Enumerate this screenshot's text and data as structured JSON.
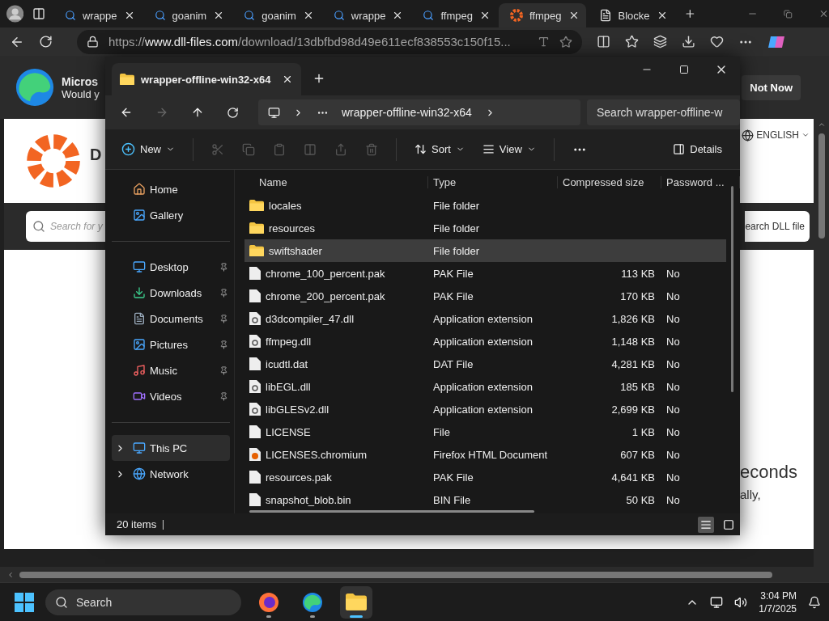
{
  "browser": {
    "tabs": [
      {
        "title": "wrappe",
        "kind": "search",
        "selected": false
      },
      {
        "title": "goanim",
        "kind": "search",
        "selected": false
      },
      {
        "title": "goanim",
        "kind": "search",
        "selected": false
      },
      {
        "title": "wrappe",
        "kind": "search",
        "selected": false
      },
      {
        "title": "ffmpeg",
        "kind": "search",
        "selected": false
      },
      {
        "title": "ffmpeg",
        "kind": "gear",
        "selected": true
      },
      {
        "title": "Blocke",
        "kind": "page",
        "selected": false
      }
    ],
    "address": "https://**www.dll-files.com**/download/13dbfbd98d49e611ecf838553c150f15...",
    "infobar": {
      "title": "Micros",
      "subtitle": "Would y",
      "button": "Not Now"
    },
    "site": {
      "title": "D",
      "search_placeholder": "Search for y",
      "search_button": "earch DLL file",
      "language": "ENGLISH",
      "heading": "econds",
      "text": "ally,"
    }
  },
  "explorer": {
    "tab": "wrapper-offline-win32-x64",
    "breadcrumb": "wrapper-offline-win32-x64",
    "search_placeholder": "Search wrapper-offline-w",
    "toolbar": {
      "new": "New",
      "sort": "Sort",
      "view": "View",
      "details": "Details"
    },
    "nav_groups": [
      [
        {
          "label": "Home",
          "kind": "home",
          "pinned": false,
          "selected": false
        },
        {
          "label": "Gallery",
          "kind": "gallery",
          "pinned": false,
          "selected": false
        }
      ],
      [
        {
          "label": "Desktop",
          "kind": "desktop",
          "pinned": true,
          "selected": false
        },
        {
          "label": "Downloads",
          "kind": "downloads",
          "pinned": true,
          "selected": false
        },
        {
          "label": "Documents",
          "kind": "documents",
          "pinned": true,
          "selected": false
        },
        {
          "label": "Pictures",
          "kind": "pictures",
          "pinned": true,
          "selected": false
        },
        {
          "label": "Music",
          "kind": "music",
          "pinned": true,
          "selected": false
        },
        {
          "label": "Videos",
          "kind": "videos",
          "pinned": true,
          "selected": false
        }
      ],
      [
        {
          "label": "This PC",
          "kind": "pc",
          "pinned": false,
          "selected": true,
          "expanded": false
        },
        {
          "label": "Network",
          "kind": "network",
          "pinned": false,
          "selected": false,
          "expanded": false
        }
      ]
    ],
    "columns": [
      "Name",
      "Type",
      "Compressed size",
      "Password ..."
    ],
    "files": [
      {
        "name": "locales",
        "kind": "folder",
        "type": "File folder",
        "selected": false
      },
      {
        "name": "resources",
        "kind": "folder",
        "type": "File folder",
        "selected": false
      },
      {
        "name": "swiftshader",
        "kind": "folder",
        "type": "File folder",
        "selected": true
      },
      {
        "name": "chrome_100_percent.pak",
        "kind": "file",
        "type": "PAK File",
        "size": "113 KB",
        "password": "No",
        "selected": false
      },
      {
        "name": "chrome_200_percent.pak",
        "kind": "file",
        "type": "PAK File",
        "size": "170 KB",
        "password": "No",
        "selected": false
      },
      {
        "name": "d3dcompiler_47.dll",
        "kind": "dll",
        "type": "Application extension",
        "size": "1,826 KB",
        "password": "No",
        "selected": false
      },
      {
        "name": "ffmpeg.dll",
        "kind": "dll",
        "type": "Application extension",
        "size": "1,148 KB",
        "password": "No",
        "selected": false
      },
      {
        "name": "icudtl.dat",
        "kind": "file",
        "type": "DAT File",
        "size": "4,281 KB",
        "password": "No",
        "selected": false
      },
      {
        "name": "libEGL.dll",
        "kind": "dll",
        "type": "Application extension",
        "size": "185 KB",
        "password": "No",
        "selected": false
      },
      {
        "name": "libGLESv2.dll",
        "kind": "dll",
        "type": "Application extension",
        "size": "2,699 KB",
        "password": "No",
        "selected": false
      },
      {
        "name": "LICENSE",
        "kind": "file",
        "type": "File",
        "size": "1 KB",
        "password": "No",
        "selected": false
      },
      {
        "name": "LICENSES.chromium",
        "kind": "html",
        "type": "Firefox HTML Document",
        "size": "607 KB",
        "password": "No",
        "selected": false
      },
      {
        "name": "resources.pak",
        "kind": "file",
        "type": "PAK File",
        "size": "4,641 KB",
        "password": "No",
        "selected": false
      },
      {
        "name": "snapshot_blob.bin",
        "kind": "file",
        "type": "BIN File",
        "size": "50 KB",
        "password": "No",
        "selected": false
      }
    ],
    "status": "20 items",
    "view_buttons": [
      {
        "kind": "details",
        "selected": true
      },
      {
        "kind": "tiles",
        "selected": false
      }
    ]
  },
  "taskbar": {
    "search": "Search",
    "apps": [
      {
        "kind": "firefox",
        "selected": false
      },
      {
        "kind": "edge",
        "selected": false
      },
      {
        "kind": "explorer",
        "selected": true
      }
    ],
    "time": "3:04 PM",
    "date": "1/7/2025"
  }
}
